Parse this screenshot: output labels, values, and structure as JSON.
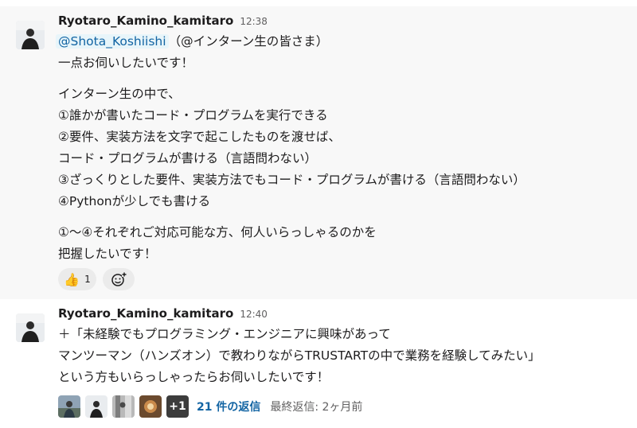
{
  "messages": [
    {
      "author": "Ryotaro_Kamino_kamitaro",
      "time": "12:38",
      "mention": "@Shota_Koshiishi",
      "mention_suffix": "（@インターン生の皆さま）",
      "lines": [
        "一点お伺いしたいです！",
        "インターン生の中で、",
        "①誰かが書いたコード・プログラムを実行できる",
        "②要件、実装方法を文字で起こしたものを渡せば、",
        "コード・プログラムが書ける（言語問わない）",
        "③ざっくりとした要件、実装方法でもコード・プログラムが書ける（言語問わない）",
        "④Pythonが少しでも書ける",
        "①〜④それぞれご対応可能な方、何人いらっしゃるのかを",
        "把握したいです！"
      ],
      "reactions": [
        {
          "emoji": "👍",
          "count": "1"
        }
      ],
      "add_reaction_icon": "add-reaction-icon"
    },
    {
      "author": "Ryotaro_Kamino_kamitaro",
      "time": "12:40",
      "lines": [
        "＋「未経験でもプログラミング・エンジニアに興味があって",
        "マンツーマン（ハンズオン）で教わりながらTRUSTARTの中で業務を経験してみたい」",
        "という方もいらっしゃったらお伺いしたいです！"
      ],
      "thread": {
        "more_count": "+1",
        "reply_count": "21 件の返信",
        "last_reply": "最終返信: 2ヶ月前"
      }
    }
  ],
  "colors": {
    "link": "#1264a3",
    "mention_bg": "#e8f5fa",
    "highlight_bg": "#f8f8f8",
    "text": "#1d1c1d",
    "muted": "#616061"
  }
}
